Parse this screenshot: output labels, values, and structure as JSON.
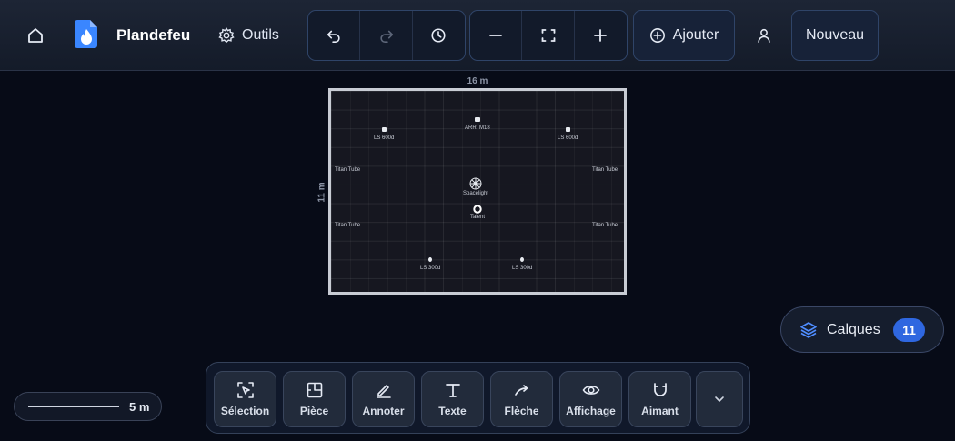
{
  "app": {
    "name": "Plandefeu"
  },
  "topbar": {
    "tools_label": "Outils",
    "add_label": "Ajouter",
    "new_label": "Nouveau"
  },
  "plan": {
    "width_label": "16 m",
    "height_label": "11 m",
    "fixtures": [
      {
        "label": "LS 600d"
      },
      {
        "label": "ARRI M18"
      },
      {
        "label": "LS 600d"
      },
      {
        "label": "Spacelight"
      },
      {
        "label": "Talent"
      },
      {
        "label": "LS 300d"
      },
      {
        "label": "LS 300d"
      }
    ],
    "side_labels": [
      "Titan Tube",
      "Titan Tube",
      "Titan Tube",
      "Titan Tube"
    ]
  },
  "layers": {
    "label": "Calques",
    "count": "11"
  },
  "scale": {
    "label": "5 m"
  },
  "toolbar": {
    "tools": [
      {
        "label": "Sélection",
        "icon": "selection-icon"
      },
      {
        "label": "Pièce",
        "icon": "room-icon"
      },
      {
        "label": "Annoter",
        "icon": "pencil-icon"
      },
      {
        "label": "Texte",
        "icon": "text-icon"
      },
      {
        "label": "Flèche",
        "icon": "arrow-icon"
      },
      {
        "label": "Affichage",
        "icon": "eye-icon"
      },
      {
        "label": "Aimant",
        "icon": "magnet-icon"
      }
    ]
  },
  "colors": {
    "accent": "#2f67e0",
    "background": "#070b17",
    "logo": "#3a86ff"
  }
}
